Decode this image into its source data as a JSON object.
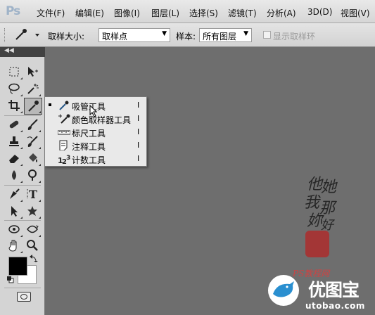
{
  "menubar": {
    "logo": "Ps",
    "items": [
      "文件(F)",
      "编辑(E)",
      "图像(I)",
      "图层(L)",
      "选择(S)",
      "滤镜(T)",
      "分析(A)",
      "3D(D)",
      "视图(V)"
    ]
  },
  "options": {
    "sample_size_label": "取样大小:",
    "sample_size_value": "取样点",
    "sample_label": "样本:",
    "sample_value": "所有图层",
    "show_ring_label": "显示取样环"
  },
  "tools": {
    "colors": {
      "foreground": "#000000",
      "background": "#ffffff"
    }
  },
  "flyout": {
    "items": [
      {
        "label": "吸管工具",
        "shortcut": "I",
        "icon": "eyedropper-icon"
      },
      {
        "label": "颜色取样器工具",
        "shortcut": "I",
        "icon": "color-sampler-icon"
      },
      {
        "label": "标尺工具",
        "shortcut": "I",
        "icon": "ruler-icon"
      },
      {
        "label": "注释工具",
        "shortcut": "I",
        "icon": "note-icon"
      },
      {
        "label": "计数工具",
        "shortcut": "I",
        "icon": "count-icon"
      }
    ]
  },
  "watermark": {
    "calligraphy": [
      "他",
      "她",
      "我",
      "那",
      "妳",
      "好"
    ],
    "signature": "PS教程网",
    "site_name": "优图宝",
    "site_url": "utobao.com"
  }
}
